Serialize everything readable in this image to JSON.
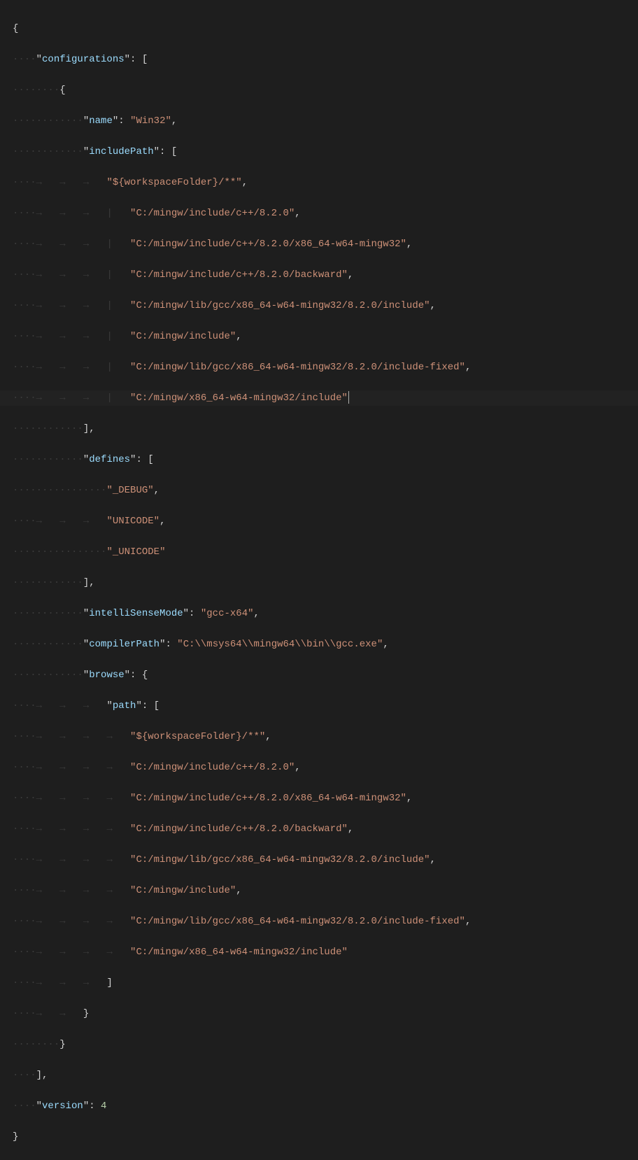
{
  "code": {
    "configurations_key": "configurations",
    "name_key": "name",
    "name_val": "Win32",
    "includePath_key": "includePath",
    "includePaths": [
      "${workspaceFolder}/**",
      "C:/mingw/include/c++/8.2.0",
      "C:/mingw/include/c++/8.2.0/x86_64-w64-mingw32",
      "C:/mingw/include/c++/8.2.0/backward",
      "C:/mingw/lib/gcc/x86_64-w64-mingw32/8.2.0/include",
      "C:/mingw/include",
      "C:/mingw/lib/gcc/x86_64-w64-mingw32/8.2.0/include-fixed",
      "C:/mingw/x86_64-w64-mingw32/include"
    ],
    "defines_key": "defines",
    "defines": [
      "_DEBUG",
      "UNICODE",
      "_UNICODE"
    ],
    "intelliSenseMode_key": "intelliSenseMode",
    "intelliSenseMode_val": "gcc-x64",
    "compilerPath_key": "compilerPath",
    "compilerPath_val": "C:\\\\msys64\\\\mingw64\\\\bin\\\\gcc.exe",
    "browse_key": "browse",
    "path_key": "path",
    "browsePaths": [
      "${workspaceFolder}/**",
      "C:/mingw/include/c++/8.2.0",
      "C:/mingw/include/c++/8.2.0/x86_64-w64-mingw32",
      "C:/mingw/include/c++/8.2.0/backward",
      "C:/mingw/lib/gcc/x86_64-w64-mingw32/8.2.0/include",
      "C:/mingw/include",
      "C:/mingw/lib/gcc/x86_64-w64-mingw32/8.2.0/include-fixed",
      "C:/mingw/x86_64-w64-mingw32/include"
    ],
    "version_key": "version",
    "version_val": 4
  },
  "ws": {
    "d1": "····",
    "a1": "→   ",
    "pipe": "|   "
  }
}
